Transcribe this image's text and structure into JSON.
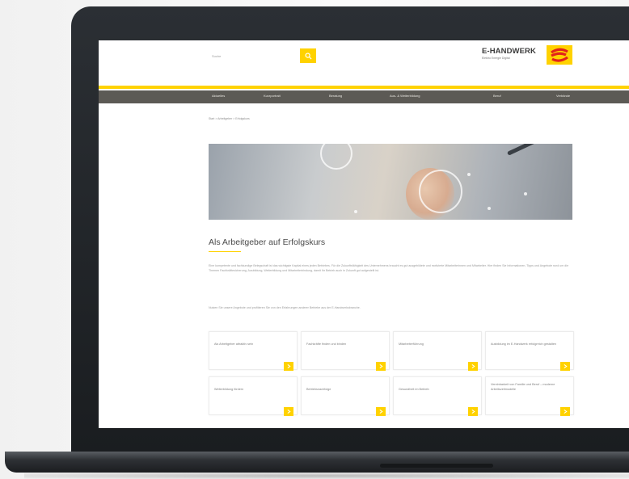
{
  "header": {
    "search_placeholder": "Suche",
    "logo_title": "E-HANDWERK",
    "logo_subtitle": "Elektro Energie Digital"
  },
  "nav": {
    "items": [
      "Aktuelles",
      "Kurzportrait",
      "Beratung",
      "Aus- & Weiterbildung",
      "Beruf",
      "Verbände"
    ]
  },
  "breadcrumb": "Start > Arbeitgeber > Erfolgskurs",
  "main": {
    "heading": "Als Arbeitgeber auf Erfolgskurs",
    "paragraph1": "Eine kompetente und fachkundige Belegschaft ist das wichtigste Kapital eines jeden Betriebes. Für die Zukunftsfähigkeit des Unternehmens braucht es gut ausgebildete und motivierte Mitarbeiterinnen und Mitarbeiter. Hier finden Sie Informationen, Tipps und Angebote rund um die Themen Fachkräftesicherung, Ausbildung, Weiterbildung und Mitarbeiterbindung, damit Ihr Betrieb auch in Zukunft gut aufgestellt ist.",
    "paragraph2": "Nutzen Sie unsere Angebote und profitieren Sie von den Erfahrungen anderer Betriebe aus der E-Handwerksbranche."
  },
  "cards": [
    {
      "label": "Als Arbeitgeber attraktiv sein"
    },
    {
      "label": "Fachkräfte finden und binden"
    },
    {
      "label": "Mitarbeiterführung"
    },
    {
      "label": "Ausbildung im E-Handwerk erfolgreich gestalten"
    },
    {
      "label": "Weiterbildung fördern"
    },
    {
      "label": "Betriebsnachfolge"
    },
    {
      "label": "Gesundheit im Betrieb"
    },
    {
      "label": "Vereinbarkeit von Familie und Beruf – moderne Arbeitszeitmodelle"
    }
  ],
  "colors": {
    "accent": "#ffd200",
    "nav_background": "#5c5a55",
    "laptop_frame": "#1f2226"
  },
  "icons": [
    "search-icon",
    "arrow-right-icon",
    "e-handwerk-logo-mark"
  ]
}
